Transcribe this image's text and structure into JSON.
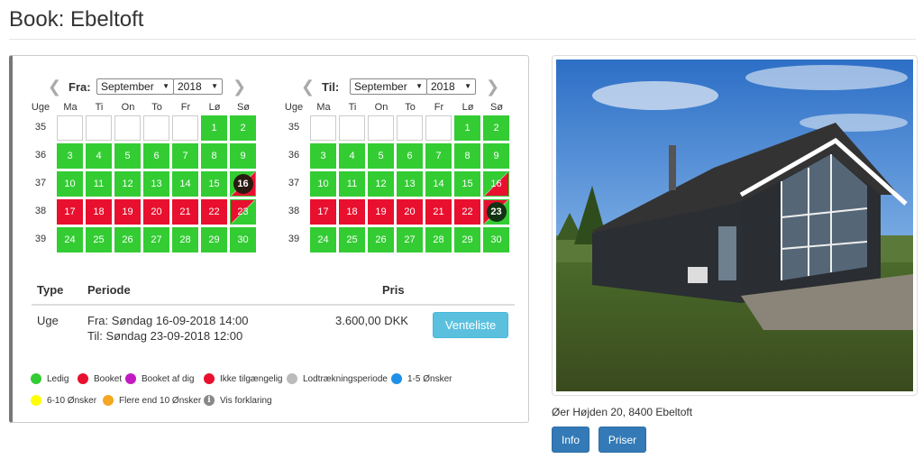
{
  "page": {
    "title": "Book: Ebeltoft"
  },
  "calendars": [
    {
      "label": "Fra:",
      "month": "September",
      "year": "2018",
      "week_header": "Uge",
      "days": [
        "Ma",
        "Ti",
        "On",
        "To",
        "Fr",
        "Lø",
        "Sø"
      ],
      "weeks": [
        {
          "nr": "35",
          "cells": [
            null,
            null,
            null,
            null,
            null,
            {
              "d": "1",
              "s": "g"
            },
            {
              "d": "2",
              "s": "g"
            }
          ]
        },
        {
          "nr": "36",
          "cells": [
            {
              "d": "3",
              "s": "g"
            },
            {
              "d": "4",
              "s": "g"
            },
            {
              "d": "5",
              "s": "g"
            },
            {
              "d": "6",
              "s": "g"
            },
            {
              "d": "7",
              "s": "g"
            },
            {
              "d": "8",
              "s": "g"
            },
            {
              "d": "9",
              "s": "g"
            }
          ]
        },
        {
          "nr": "37",
          "cells": [
            {
              "d": "10",
              "s": "g"
            },
            {
              "d": "11",
              "s": "g"
            },
            {
              "d": "12",
              "s": "g"
            },
            {
              "d": "13",
              "s": "g"
            },
            {
              "d": "14",
              "s": "g"
            },
            {
              "d": "15",
              "s": "g"
            },
            {
              "d": "16",
              "s": "gr",
              "selected": true
            }
          ]
        },
        {
          "nr": "38",
          "cells": [
            {
              "d": "17",
              "s": "r"
            },
            {
              "d": "18",
              "s": "r"
            },
            {
              "d": "19",
              "s": "r"
            },
            {
              "d": "20",
              "s": "r"
            },
            {
              "d": "21",
              "s": "r"
            },
            {
              "d": "22",
              "s": "r"
            },
            {
              "d": "23",
              "s": "rg"
            }
          ]
        },
        {
          "nr": "39",
          "cells": [
            {
              "d": "24",
              "s": "g"
            },
            {
              "d": "25",
              "s": "g"
            },
            {
              "d": "26",
              "s": "g"
            },
            {
              "d": "27",
              "s": "g"
            },
            {
              "d": "28",
              "s": "g"
            },
            {
              "d": "29",
              "s": "g"
            },
            {
              "d": "30",
              "s": "g"
            }
          ]
        }
      ]
    },
    {
      "label": "Til:",
      "month": "September",
      "year": "2018",
      "week_header": "Uge",
      "days": [
        "Ma",
        "Ti",
        "On",
        "To",
        "Fr",
        "Lø",
        "Sø"
      ],
      "weeks": [
        {
          "nr": "35",
          "cells": [
            null,
            null,
            null,
            null,
            null,
            {
              "d": "1",
              "s": "g"
            },
            {
              "d": "2",
              "s": "g"
            }
          ]
        },
        {
          "nr": "36",
          "cells": [
            {
              "d": "3",
              "s": "g"
            },
            {
              "d": "4",
              "s": "g"
            },
            {
              "d": "5",
              "s": "g"
            },
            {
              "d": "6",
              "s": "g"
            },
            {
              "d": "7",
              "s": "g"
            },
            {
              "d": "8",
              "s": "g"
            },
            {
              "d": "9",
              "s": "g"
            }
          ]
        },
        {
          "nr": "37",
          "cells": [
            {
              "d": "10",
              "s": "g"
            },
            {
              "d": "11",
              "s": "g"
            },
            {
              "d": "12",
              "s": "g"
            },
            {
              "d": "13",
              "s": "g"
            },
            {
              "d": "14",
              "s": "g"
            },
            {
              "d": "15",
              "s": "g"
            },
            {
              "d": "16",
              "s": "gr"
            }
          ]
        },
        {
          "nr": "38",
          "cells": [
            {
              "d": "17",
              "s": "r"
            },
            {
              "d": "18",
              "s": "r"
            },
            {
              "d": "19",
              "s": "r"
            },
            {
              "d": "20",
              "s": "r"
            },
            {
              "d": "21",
              "s": "r"
            },
            {
              "d": "22",
              "s": "r"
            },
            {
              "d": "23",
              "s": "rg",
              "selected": true
            }
          ]
        },
        {
          "nr": "39",
          "cells": [
            {
              "d": "24",
              "s": "g"
            },
            {
              "d": "25",
              "s": "g"
            },
            {
              "d": "26",
              "s": "g"
            },
            {
              "d": "27",
              "s": "g"
            },
            {
              "d": "28",
              "s": "g"
            },
            {
              "d": "29",
              "s": "g"
            },
            {
              "d": "30",
              "s": "g"
            }
          ]
        }
      ]
    }
  ],
  "table": {
    "headers": {
      "type": "Type",
      "period": "Periode",
      "price": "Pris"
    },
    "row": {
      "type": "Uge",
      "from": "Fra: Søndag 16-09-2018 14:00",
      "to": "Til: Søndag 23-09-2018 12:00",
      "price": "3.600,00 DKK",
      "button": "Venteliste"
    }
  },
  "legend": [
    {
      "label": "Ledig",
      "color": "#33cc33"
    },
    {
      "label": "Booket",
      "color": "#e8102e"
    },
    {
      "label": "Booket af dig",
      "color": "#c21bc2"
    },
    {
      "label": "Ikke tilgængelig",
      "color": "#e8102e"
    },
    {
      "label": "Lodtrækningsperiode",
      "color": "#bbbbbb"
    },
    {
      "label": "1-5 Ønsker",
      "color": "#1e90e8"
    },
    {
      "label": "6-10 Ønsker",
      "color": "#ffff00"
    },
    {
      "label": "Flere end 10 Ønsker",
      "color": "#f5a623"
    },
    {
      "label": "Vis forklaring",
      "icon": "info-icon"
    }
  ],
  "property": {
    "address": "Øer Højden 20, 8400 Ebeltoft",
    "info_button": "Info",
    "prices_button": "Priser"
  }
}
